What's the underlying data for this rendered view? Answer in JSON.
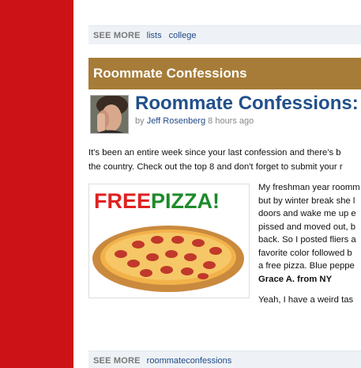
{
  "see_more_top": {
    "label": "SEE MORE",
    "links": [
      "lists",
      "college"
    ]
  },
  "section": {
    "title": "Roommate Confessions"
  },
  "article": {
    "title": "Roommate Confessions:",
    "byline_prefix": "by",
    "author": "Jeff Rosenberg",
    "time": "8 hours ago",
    "intro_lines": [
      "It's been an entire week since your last confession and there's b",
      "the country. Check out the top 8 and don't forget to submit your r"
    ],
    "promo": {
      "word_free": "FREE",
      "word_pizza": "PIZZA!"
    },
    "body_lines": [
      "My freshman year roomm",
      "but by winter break she l",
      "doors and wake me up e",
      "pissed and moved out, b",
      "back. So I posted fliers a",
      "favorite color followed b",
      "a free pizza. Blue peppe"
    ],
    "signature": "Grace A. from NY",
    "second_paragraph": "Yeah, I have a weird tas"
  },
  "see_more_bottom": {
    "label": "SEE MORE",
    "links": [
      "roommateconfessions"
    ]
  },
  "colors": {
    "left_bar": "#cc1216",
    "banner": "#a67c38",
    "title": "#22508a",
    "link": "#1f4a86",
    "free_red": "#e02020",
    "pizza_green": "#1d8a2a"
  }
}
